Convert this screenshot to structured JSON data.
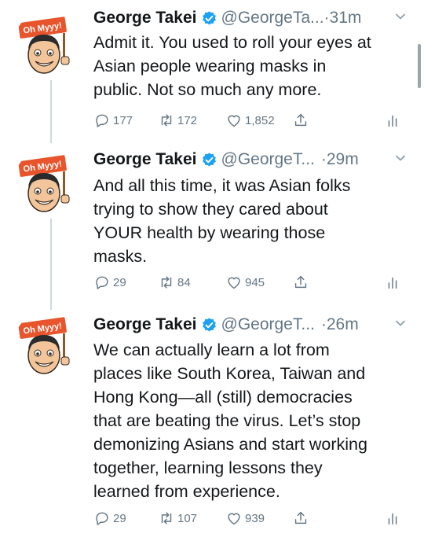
{
  "thread": [
    {
      "author": "George Takei",
      "handle": "@GeorgeTa...",
      "time": "·31m",
      "avatar_badge": "Oh Myyy!",
      "lines": [
        "Admit it. You used to roll your eyes at",
        "Asian people wearing masks in",
        "public. Not so much any more."
      ],
      "replies": "177",
      "retweets": "172",
      "likes": "1,852"
    },
    {
      "author": "George Takei",
      "handle": "@GeorgeT...",
      "time": "·29m",
      "avatar_badge": "Oh Myyy!",
      "lines": [
        "And all this time, it was Asian folks",
        "trying to show they cared about",
        "YOUR health by wearing those",
        "masks."
      ],
      "replies": "29",
      "retweets": "84",
      "likes": "945"
    },
    {
      "author": "George Takei",
      "handle": "@GeorgeT...",
      "time": "·26m",
      "avatar_badge": "Oh Myyy!",
      "lines": [
        "We can actually learn a lot from",
        "places like South Korea, Taiwan and",
        "Hong Kong—all (still) democracies",
        "that are beating the virus. Let’s stop",
        "demonizing Asians and start working",
        "together, learning lessons they",
        "learned from experience."
      ],
      "replies": "29",
      "retweets": "107",
      "likes": "939"
    }
  ],
  "icons": {
    "reply": "reply-icon",
    "retweet": "retweet-icon",
    "like": "like-icon",
    "share": "share-icon",
    "analytics": "analytics-icon",
    "verified": "verified-badge-icon",
    "more": "chevron-down-icon"
  },
  "colors": {
    "text": "#14171a",
    "muted": "#657786",
    "verified": "#1da1f2",
    "badge": "#e8542c",
    "thread_line": "#cfd9de"
  }
}
